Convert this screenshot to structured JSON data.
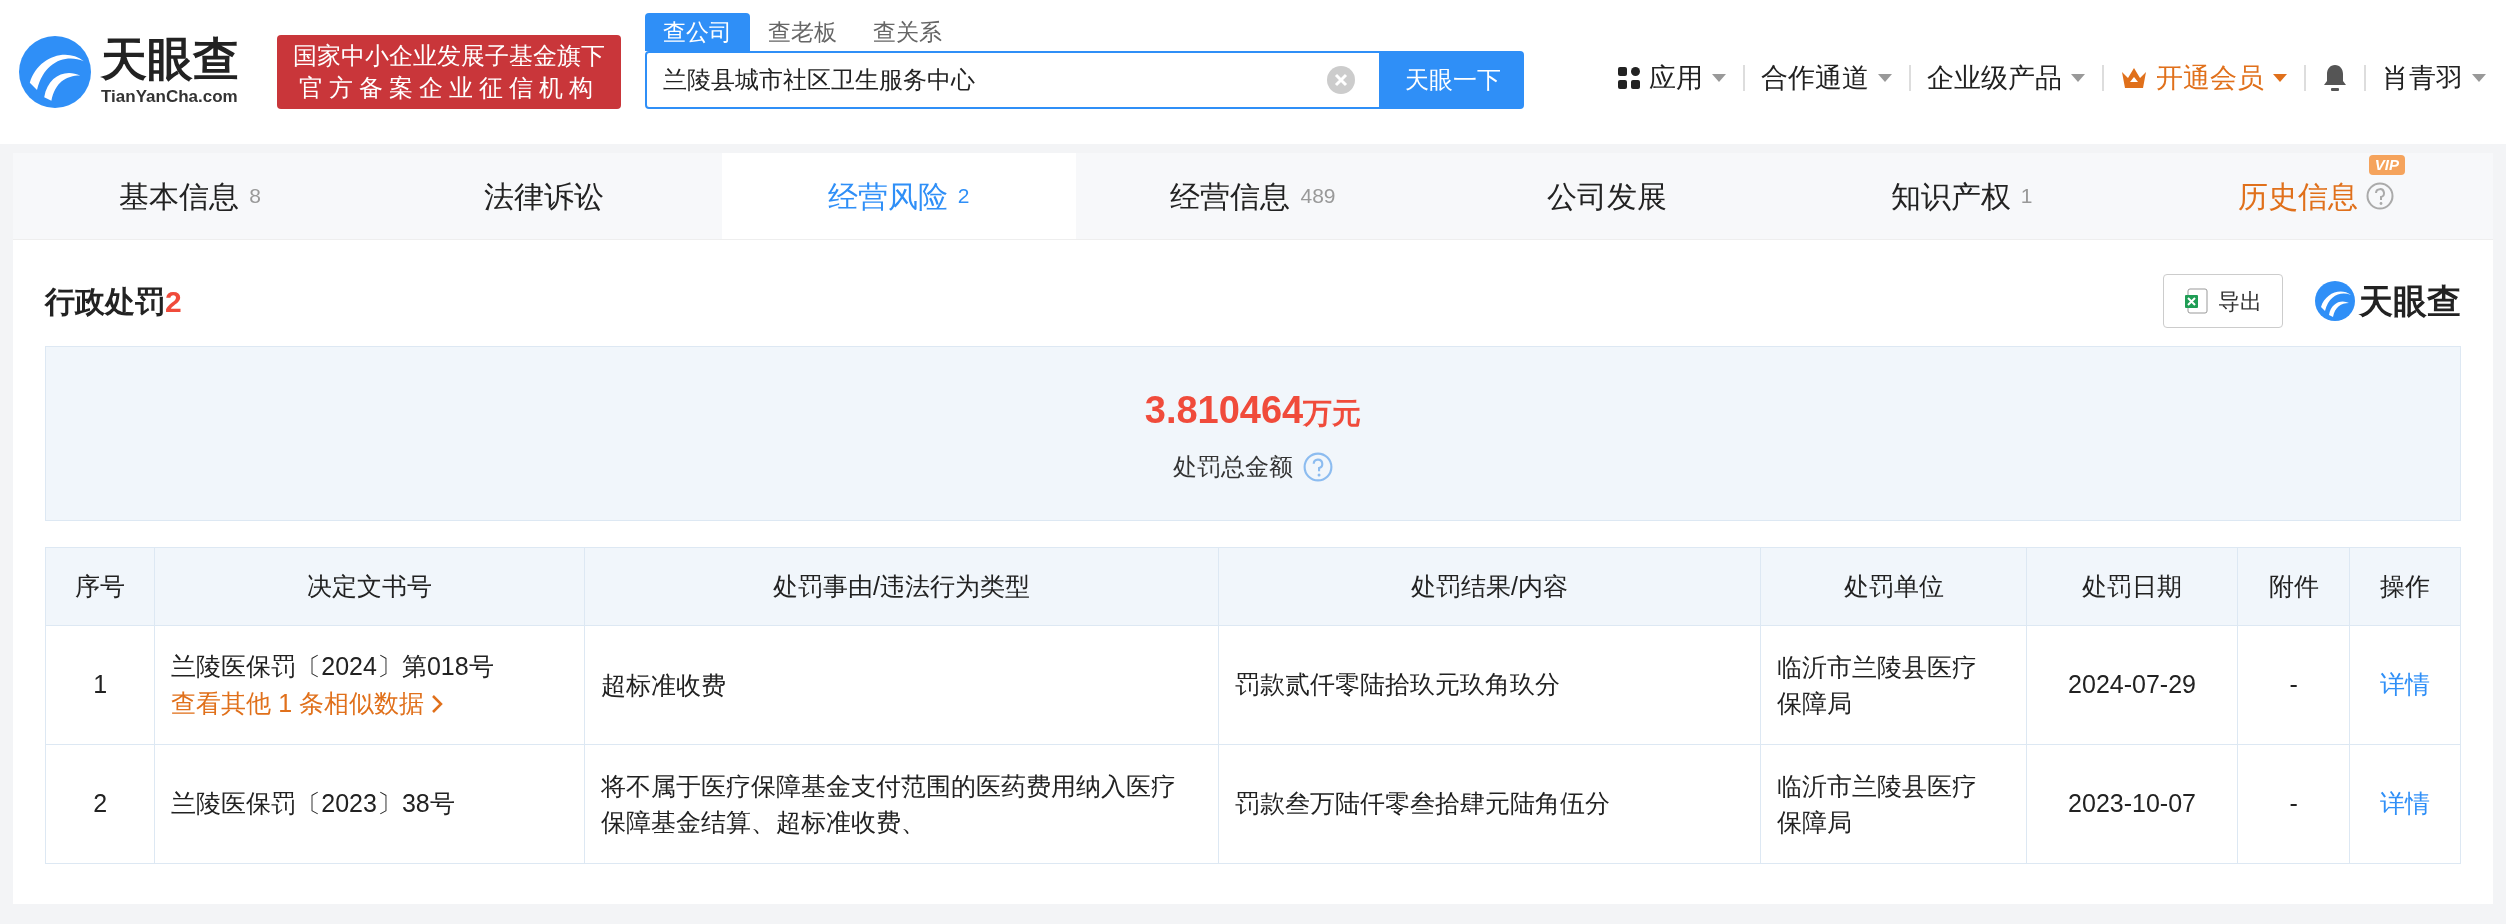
{
  "header": {
    "logo": {
      "name": "天眼查",
      "domain": "TianYanCha.com"
    },
    "badge": [
      "国家中小企业发展子基金旗下",
      "官方备案企业征信机构"
    ],
    "search": {
      "tabs": [
        {
          "label": "查公司",
          "selected": true
        },
        {
          "label": "查老板",
          "selected": false
        },
        {
          "label": "查关系",
          "selected": false
        }
      ],
      "value": "兰陵县城市社区卫生服务中心",
      "button": "天眼一下"
    },
    "nav": [
      {
        "label": "应用",
        "kind": "apps"
      },
      {
        "label": "合作通道",
        "kind": "plain"
      },
      {
        "label": "企业级产品",
        "kind": "plain"
      },
      {
        "label": "开通会员",
        "kind": "vip"
      },
      {
        "kind": "bell"
      },
      {
        "label": "肖青羽",
        "kind": "plain"
      }
    ]
  },
  "tabs": [
    {
      "label": "基本信息",
      "count": "8",
      "selected": false,
      "kind": "plain"
    },
    {
      "label": "法律诉讼",
      "selected": false,
      "kind": "plain"
    },
    {
      "label": "经营风险",
      "count": "2",
      "selected": true,
      "kind": "plain"
    },
    {
      "label": "经营信息",
      "count": "489",
      "selected": false,
      "kind": "plain"
    },
    {
      "label": "公司发展",
      "selected": false,
      "kind": "plain"
    },
    {
      "label": "知识产权",
      "count": "1",
      "selected": false,
      "kind": "plain"
    },
    {
      "label": "历史信息",
      "badge": "VIP",
      "selected": false,
      "kind": "vip"
    }
  ],
  "section": {
    "title": "行政处罚",
    "count": "2",
    "export": "导出",
    "brand": "天眼查"
  },
  "summary": {
    "amount": "3.810464",
    "unit": "万元",
    "label": "处罚总金额"
  },
  "table": {
    "columns": [
      "序号",
      "决定文书号",
      "处罚事由/违法行为类型",
      "处罚结果/内容",
      "处罚单位",
      "处罚日期",
      "附件",
      "操作"
    ],
    "rows": [
      {
        "index": "1",
        "doc": "兰陵医保罚〔2024〕第018号",
        "similar": "查看其他 1 条相似数据",
        "reason": "超标准收费",
        "result": "罚款贰仟零陆拾玖元玖角玖分",
        "unit": "临沂市兰陵县医疗保障局",
        "date": "2024-07-29",
        "attachment": "-",
        "action": "详情"
      },
      {
        "index": "2",
        "doc": "兰陵医保罚〔2023〕38号",
        "reason": "将不属于医疗保障基金支付范围的医药费用纳入医疗保障基金结算、超标准收费、",
        "result": "罚款叁万陆仟零叁拾肆元陆角伍分",
        "unit": "临沂市兰陵县医疗保障局",
        "date": "2023-10-07",
        "attachment": "-",
        "action": "详情"
      }
    ]
  }
}
